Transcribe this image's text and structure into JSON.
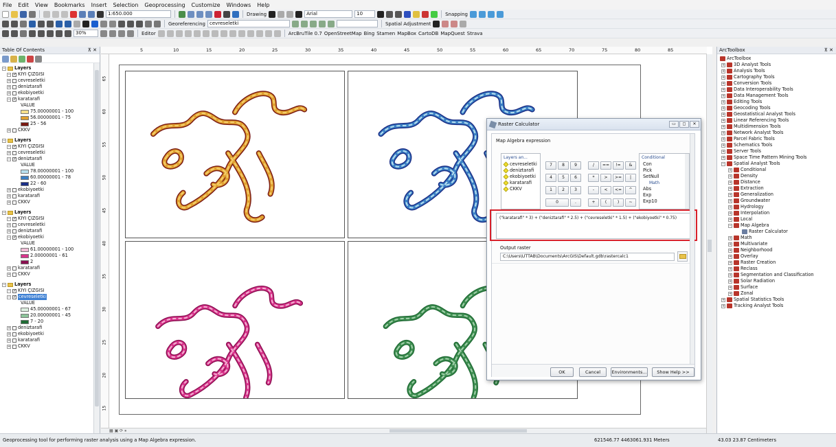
{
  "menu": [
    "File",
    "Edit",
    "View",
    "Bookmarks",
    "Insert",
    "Selection",
    "Geoprocessing",
    "Customize",
    "Windows",
    "Help"
  ],
  "toolbar1": {
    "scale": "1:650.000",
    "drawing": "Drawing",
    "font": "Arial",
    "font_size": "10",
    "snapping": "Snapping"
  },
  "toolbar2": {
    "georeferencing": "Georeferencing",
    "georef_layer": "cevreseletki",
    "spatial_adjustment": "Spatial Adjustment"
  },
  "toolbar3": {
    "zoom": "30%",
    "editor": "Editor",
    "arcbrutile": "ArcBruTile 0.7",
    "osm": "OpenStreetMap",
    "bing": "Bing",
    "stamen": "Stamen",
    "mapbox": "MapBox",
    "cartodb": "CartoDB",
    "mapquest": "MapQuest",
    "strava": "Strava"
  },
  "toc": {
    "title": "Table Of Contents",
    "pin": "&#x2715;",
    "groups": [
      {
        "name": "Layers",
        "layers": [
          {
            "name": "KIYI ÇIZGISI",
            "checked": true,
            "expanded": true
          },
          {
            "name": "cevreseletki",
            "checked": false,
            "expanded": false
          },
          {
            "name": "deniztarafi",
            "checked": false,
            "expanded": false
          },
          {
            "name": "ekobiyoetki",
            "checked": false,
            "expanded": false
          },
          {
            "name": "karatarafi",
            "checked": true,
            "expanded": true,
            "legend_title": "VALUE",
            "legend": [
              {
                "label": "75.00000001 - 100",
                "color": "#f7e08c"
              },
              {
                "label": "56.00000001 - 75",
                "color": "#e0a030"
              },
              {
                "label": "25 - 56",
                "color": "#7a1a12"
              }
            ]
          },
          {
            "name": "CKKV",
            "checked": false,
            "expanded": false
          }
        ]
      },
      {
        "name": "Layers",
        "layers": [
          {
            "name": "KIYI ÇIZGISI",
            "checked": true,
            "expanded": true
          },
          {
            "name": "cevreseletki",
            "checked": false,
            "expanded": false
          },
          {
            "name": "deniztarafi",
            "checked": true,
            "expanded": true,
            "legend_title": "VALUE",
            "legend": [
              {
                "label": "78.00000001 - 100",
                "color": "#b9e0ee"
              },
              {
                "label": "60.00000001 - 78",
                "color": "#3a7fc4"
              },
              {
                "label": "22 - 60",
                "color": "#1a2e86"
              }
            ]
          },
          {
            "name": "ekobiyoetki",
            "checked": false,
            "expanded": false
          },
          {
            "name": "karatarafi",
            "checked": false,
            "expanded": false
          },
          {
            "name": "CKKV",
            "checked": false,
            "expanded": false
          }
        ]
      },
      {
        "name": "Layers",
        "layers": [
          {
            "name": "KIYI ÇIZGISI",
            "checked": true,
            "expanded": true
          },
          {
            "name": "cevreseletki",
            "checked": false,
            "expanded": false
          },
          {
            "name": "deniztarafi",
            "checked": false,
            "expanded": false
          },
          {
            "name": "ekobiyoetki",
            "checked": true,
            "expanded": true,
            "legend_title": "VALUE",
            "legend": [
              {
                "label": "61.00000001 - 100",
                "color": "#f2bcd6"
              },
              {
                "label": "2.00000001 - 61",
                "color": "#d9348c"
              },
              {
                "label": "2",
                "color": "#8a0f50"
              }
            ]
          },
          {
            "name": "karatarafi",
            "checked": false,
            "expanded": false
          },
          {
            "name": "CKKV",
            "checked": false,
            "expanded": false
          }
        ]
      },
      {
        "name": "Layers",
        "layers": [
          {
            "name": "KIYI ÇIZGISI",
            "checked": true,
            "expanded": true
          },
          {
            "name": "cevreseletki",
            "checked": true,
            "expanded": true,
            "selected": true,
            "legend_title": "VALUE",
            "legend": [
              {
                "label": "45.00000001 - 67",
                "color": "#dcefe0"
              },
              {
                "label": "20.00000001 - 45",
                "color": "#8cc49a"
              },
              {
                "label": "7 - 20",
                "color": "#1f6b34"
              }
            ]
          },
          {
            "name": "deniztarafi",
            "checked": false,
            "expanded": false
          },
          {
            "name": "ekobiyoetki",
            "checked": false,
            "expanded": false
          },
          {
            "name": "karatarafi",
            "checked": false,
            "expanded": false
          },
          {
            "name": "CKKV",
            "checked": false,
            "expanded": false
          }
        ]
      }
    ]
  },
  "ruler_h": [
    "5",
    "10",
    "15",
    "20",
    "25",
    "30",
    "35",
    "40",
    "45",
    "50",
    "55",
    "60",
    "65",
    "70",
    "75",
    "80",
    "85"
  ],
  "ruler_v": [
    "65",
    "60",
    "55",
    "50",
    "45",
    "40",
    "35",
    "30",
    "25",
    "20",
    "15"
  ],
  "map_panels": [
    {
      "name": "karatarafi",
      "colors": [
        "#7a1a12",
        "#e0a030",
        "#f5d070"
      ]
    },
    {
      "name": "deniztarafi",
      "colors": [
        "#1a2e86",
        "#3a7fc4",
        "#b9e0ee"
      ]
    },
    {
      "name": "ekobiyoetki",
      "colors": [
        "#8a0f50",
        "#d9348c",
        "#f2bcd6"
      ]
    },
    {
      "name": "cevreseletki",
      "colors": [
        "#1f6b34",
        "#3f8f52",
        "#a8d4b0"
      ]
    }
  ],
  "arctoolbox": {
    "title": "ArcToolbox",
    "root": "ArcToolbox",
    "top_tools": [
      "3D Analyst Tools",
      "Analysis Tools",
      "Cartography Tools",
      "Conversion Tools",
      "Data Interoperability Tools",
      "Data Management Tools",
      "Editing Tools",
      "Geocoding Tools",
      "Geostatistical Analyst Tools",
      "Linear Referencing Tools",
      "Multidimension Tools",
      "Network Analyst Tools",
      "Parcel Fabric Tools",
      "Schematics Tools",
      "Server Tools",
      "Space Time Pattern Mining Tools",
      "Spatial Analyst Tools"
    ],
    "spatial_children": [
      "Conditional",
      "Density",
      "Distance",
      "Extraction",
      "Generalization",
      "Groundwater",
      "Hydrology",
      "Interpolation",
      "Local",
      "Map Algebra"
    ],
    "map_algebra_child": "Raster Calculator",
    "spatial_children2": [
      "Math",
      "Multivariate",
      "Neighborhood",
      "Overlay",
      "Raster Creation",
      "Reclass",
      "Segmentation and Classification",
      "Solar Radiation",
      "Surface",
      "Zonal"
    ],
    "bottom_tools": [
      "Spatial Statistics Tools",
      "Tracking Analyst Tools"
    ]
  },
  "dialog": {
    "title": "Raster Calculator",
    "section_label": "Map Algebra expression",
    "layers_header": "Layers an...",
    "layers": [
      "cevreseletki",
      "deniztarafi",
      "ekobiyoetki",
      "karatarafi",
      "CKKV"
    ],
    "buttons_row1": [
      "7",
      "8",
      "9",
      "/",
      "==",
      "!=",
      "&"
    ],
    "buttons_row2": [
      "4",
      "5",
      "6",
      "*",
      ">",
      ">=",
      "|"
    ],
    "buttons_row3": [
      "1",
      "2",
      "3",
      "-",
      "<",
      "<=",
      "^"
    ],
    "buttons_row4": [
      "0",
      ".",
      "+",
      "(",
      ")",
      "~"
    ],
    "functions_header": "Conditional",
    "functions": [
      "Con",
      "Pick",
      "SetNull"
    ],
    "math_header": "Math",
    "math_functions": [
      "Abs",
      "Exp",
      "Exp10"
    ],
    "expression": "(\"karatarafi\" * 3) + (\"deniztarafi\" * 2.5) + (\"cevreseletki\" * 1.5) + (\"ekobiyoetki\" * 0.75)",
    "output_label": "Output raster",
    "output_value": "C:\\Users\\UTTAB\\Documents\\ArcGIS\\Default.gdb\\rastercalc1",
    "ok": "OK",
    "cancel": "Cancel",
    "environments": "Environments...",
    "help": "Show Help >>",
    "highlight_color": "#d8202a"
  },
  "status": {
    "message": "Geoprocessing tool for performing raster analysis using a Map Algebra expression.",
    "coords": "621546.77  4463061.931 Meters",
    "page_coords": "43.03  23.87 Centimeters"
  }
}
